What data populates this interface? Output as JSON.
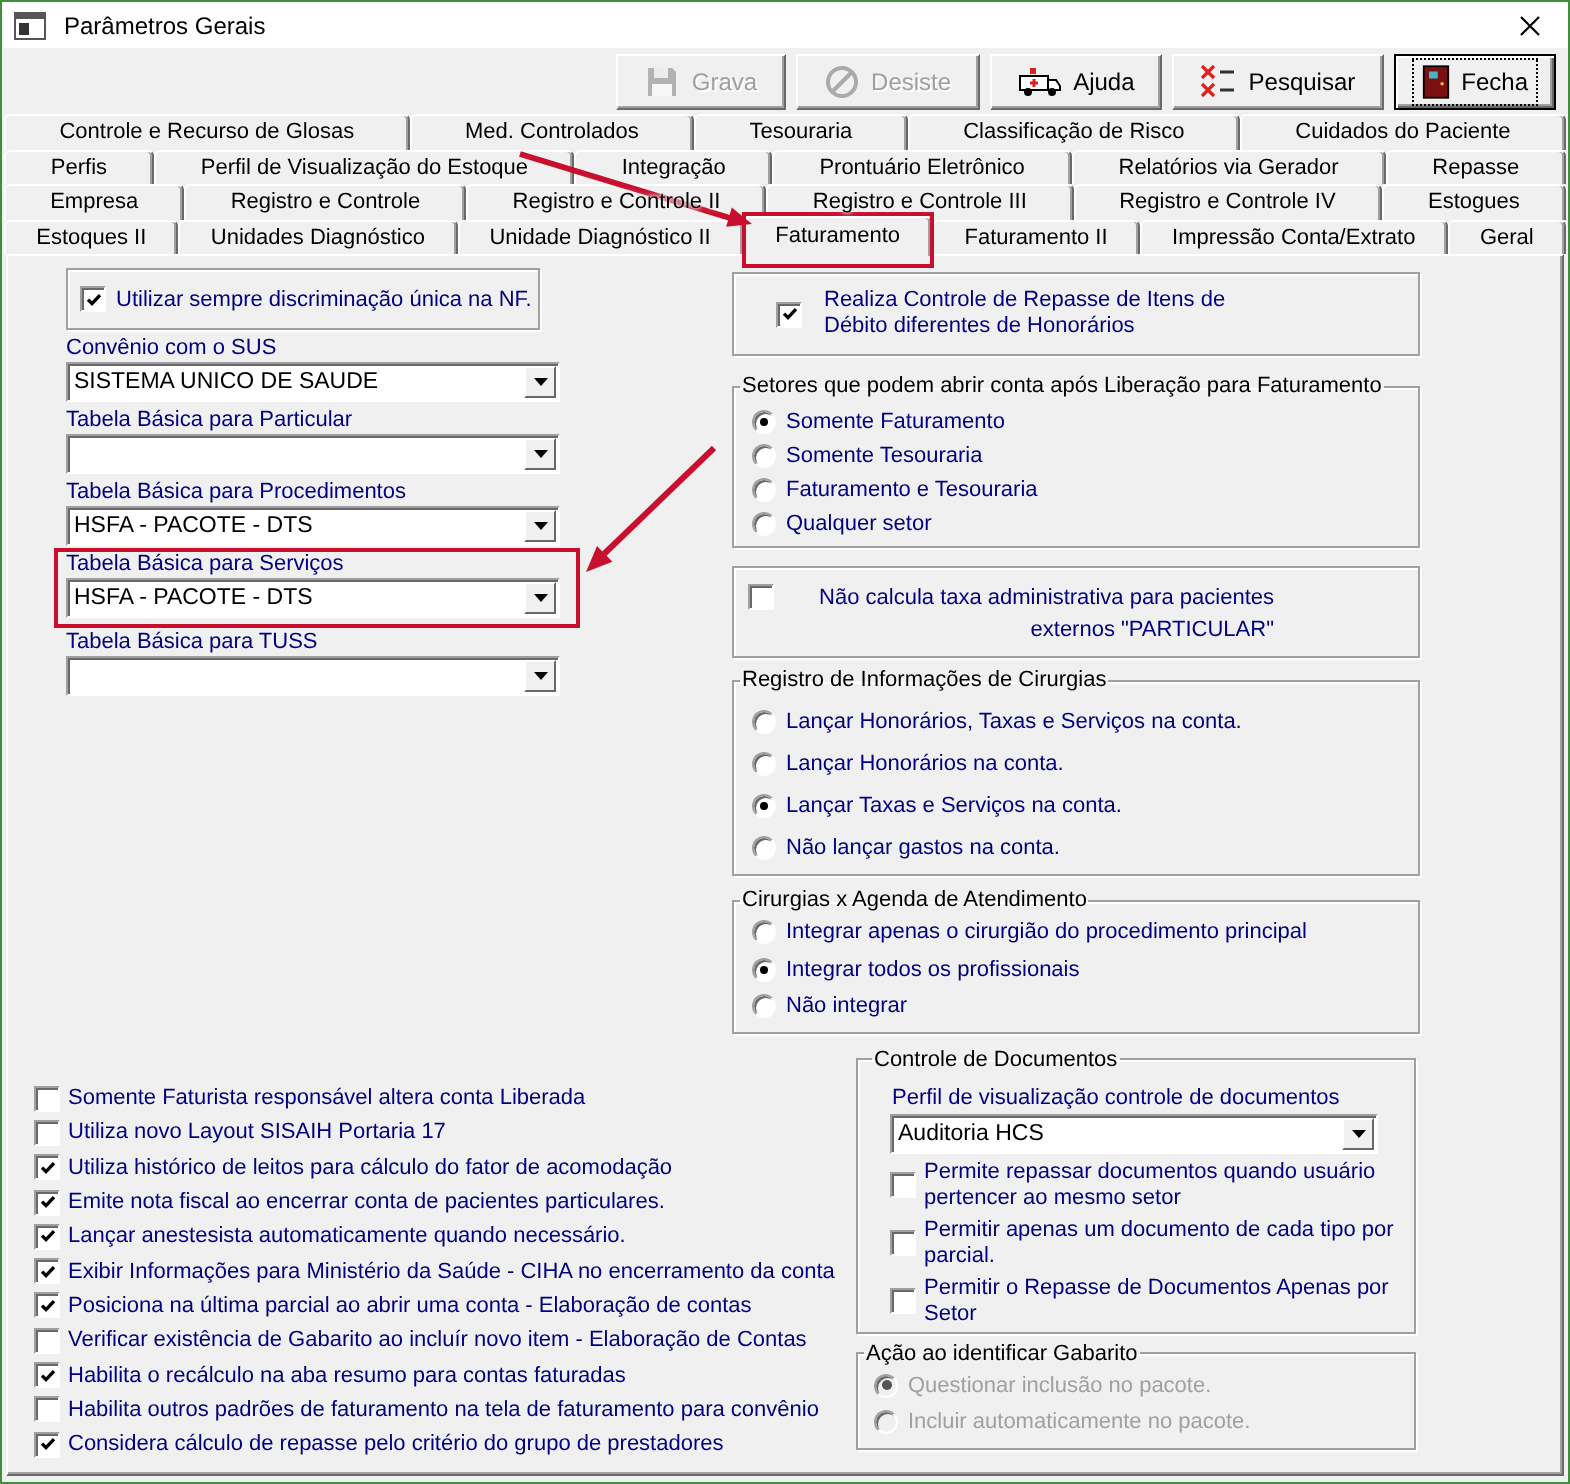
{
  "window": {
    "title": "Parâmetros Gerais"
  },
  "toolbar": [
    {
      "kind": "save",
      "label": "Grava",
      "disabled": true,
      "default": false
    },
    {
      "kind": "cancel",
      "label": "Desiste",
      "disabled": true,
      "default": false
    },
    {
      "kind": "help",
      "label": "Ajuda",
      "disabled": false,
      "default": false
    },
    {
      "kind": "search",
      "label": "Pesquisar",
      "disabled": false,
      "default": false
    },
    {
      "kind": "close",
      "label": "Fecha",
      "disabled": false,
      "default": true
    }
  ],
  "tab_rows": [
    {
      "tabs": [
        {
          "label": "Controle e Recurso de Glosas",
          "selected": false,
          "highlighted": false
        },
        {
          "label": "Med. Controlados",
          "selected": false,
          "highlighted": false
        },
        {
          "label": "Tesouraria",
          "selected": false,
          "highlighted": false
        },
        {
          "label": "Classificação de Risco",
          "selected": false,
          "highlighted": false
        },
        {
          "label": "Cuidados do Paciente",
          "selected": false,
          "highlighted": false
        }
      ]
    },
    {
      "tabs": [
        {
          "label": "Perfis",
          "selected": false,
          "highlighted": false
        },
        {
          "label": "Perfil de Visualização do Estoque",
          "selected": false,
          "highlighted": false
        },
        {
          "label": "Integração",
          "selected": false,
          "highlighted": false
        },
        {
          "label": "Prontuário Eletrônico",
          "selected": false,
          "highlighted": false
        },
        {
          "label": "Relatórios via Gerador",
          "selected": false,
          "highlighted": false
        },
        {
          "label": "Repasse",
          "selected": false,
          "highlighted": false
        }
      ]
    },
    {
      "tabs": [
        {
          "label": "Empresa",
          "selected": false,
          "highlighted": false
        },
        {
          "label": "Registro e Controle",
          "selected": false,
          "highlighted": false
        },
        {
          "label": "Registro e Controle II",
          "selected": false,
          "highlighted": false
        },
        {
          "label": "Registro e Controle III",
          "selected": false,
          "highlighted": false
        },
        {
          "label": "Registro e Controle IV",
          "selected": false,
          "highlighted": false
        },
        {
          "label": "Estogues",
          "selected": false,
          "highlighted": false
        }
      ]
    },
    {
      "tabs": [
        {
          "label": "Estoques II",
          "selected": false,
          "highlighted": false
        },
        {
          "label": "Unidades Diagnóstico",
          "selected": false,
          "highlighted": false
        },
        {
          "label": "Unidade Diagnóstico II",
          "selected": false,
          "highlighted": false
        },
        {
          "label": "Faturamento",
          "selected": true,
          "highlighted": true
        },
        {
          "label": "Faturamento II",
          "selected": false,
          "highlighted": false
        },
        {
          "label": "Impressão Conta/Extrato",
          "selected": false,
          "highlighted": false
        },
        {
          "label": "Geral",
          "selected": false,
          "highlighted": false
        }
      ]
    }
  ],
  "nf_option": {
    "label": "Utilizar sempre discriminação única na NF.",
    "checked": true
  },
  "fields": [
    {
      "label": "Convênio com o SUS",
      "value": "SISTEMA UNICO DE SAUDE",
      "highlighted": false
    },
    {
      "label": "Tabela Básica para Particular",
      "highlighted": false
    },
    {
      "label": "Tabela Básica para Procedimentos",
      "value": "HSFA - PACOTE - DTS",
      "highlighted": false
    },
    {
      "label": "Tabela Básica para Serviços",
      "value": "HSFA - PACOTE - DTS",
      "highlighted": true
    },
    {
      "label": "Tabela Básica para TUSS",
      "highlighted": false
    }
  ],
  "right_column": [
    {
      "kind": "check_box",
      "label": "Realiza Controle de Repasse de Itens de Débito diferentes de Honorários",
      "checked": true
    },
    {
      "kind": "radio_group",
      "title": "Setores que podem abrir conta após Liberação para Faturamento",
      "options": [
        {
          "label": "Somente Faturamento",
          "selected": true
        },
        {
          "label": "Somente Tesouraria",
          "selected": false
        },
        {
          "label": "Faturamento e Tesouraria",
          "selected": false
        },
        {
          "label": "Qualquer setor",
          "selected": false
        }
      ]
    },
    {
      "kind": "check_box",
      "label": "Não calcula taxa administrativa para pacientes externos \"PARTICULAR\"",
      "checked": false
    },
    {
      "kind": "radio_group",
      "title": "Registro de Informações de Cirurgias",
      "options": [
        {
          "label": "Lançar Honorários, Taxas e Serviços na conta.",
          "selected": false
        },
        {
          "label": "Lançar Honorários na conta.",
          "selected": false
        },
        {
          "label": "Lançar Taxas e Serviços na conta.",
          "selected": true
        },
        {
          "label": "Não lançar gastos na conta.",
          "selected": false
        }
      ]
    },
    {
      "kind": "radio_group",
      "title": "Cirurgias x Agenda de Atendimento",
      "options": [
        {
          "label": "Integrar apenas o cirurgião do procedimento principal",
          "selected": false
        },
        {
          "label": "Integrar todos os profissionais",
          "selected": true
        },
        {
          "label": "Não integrar",
          "selected": false
        }
      ]
    }
  ],
  "bottom_options": [
    {
      "label": "Somente Faturista responsável altera conta Liberada",
      "checked": false
    },
    {
      "label": "Utiliza novo Layout SISAIH Portaria 17",
      "checked": false
    },
    {
      "label": "Utiliza histórico de leitos para cálculo do fator de acomodação",
      "checked": true
    },
    {
      "label": "Emite nota fiscal ao encerrar conta de pacientes particulares.",
      "checked": true
    },
    {
      "label": "Lançar anestesista automaticamente quando necessário.",
      "checked": true
    },
    {
      "label": "Exibir Informações para Ministério da Saúde - CIHA no encerramento da conta",
      "checked": true
    },
    {
      "label": "Posiciona na última parcial ao abrir uma conta - Elaboração de contas",
      "checked": true
    },
    {
      "label": "Verificar existência de Gabarito ao incluír novo item - Elaboração de Contas",
      "checked": false
    },
    {
      "label": "Habilita o recálculo na aba resumo para contas faturadas",
      "checked": true
    },
    {
      "label": "Habilita outros padrões de faturamento na tela de faturamento para convênio",
      "checked": false
    },
    {
      "label": "Considera cálculo de repasse pelo critério do grupo de prestadores",
      "checked": true
    }
  ],
  "documents": {
    "title": "Controle de Documentos",
    "field": {
      "label": "Perfil de visualização controle de documentos",
      "value": "Auditoria HCS"
    },
    "options": [
      {
        "label": "Permite repassar documentos quando usuário pertencer ao mesmo setor",
        "checked": false
      },
      {
        "label": "Permitir apenas um documento de cada tipo por parcial.",
        "checked": false
      },
      {
        "label": "Permitir o Repasse de Documentos Apenas por Setor",
        "checked": false
      }
    ]
  },
  "gabarito": {
    "title": "Ação ao identificar Gabarito",
    "disabled": true,
    "options": [
      {
        "label": "Questionar inclusão no pacote.",
        "selected": true
      },
      {
        "label": "Incluir automaticamente no pacote.",
        "selected": false
      }
    ]
  }
}
